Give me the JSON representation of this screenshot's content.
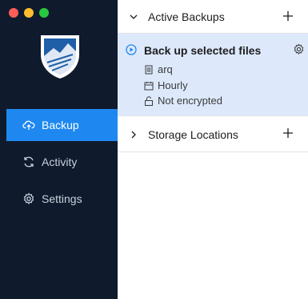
{
  "window": {
    "controls": {
      "close_color": "#ff5f57",
      "minimize_color": "#febc2e",
      "zoom_color": "#28c840"
    }
  },
  "sidebar": {
    "logo_icon": "arq-shield-logo",
    "items": [
      {
        "label": "Backup",
        "icon": "backup-cloud-icon",
        "active": true
      },
      {
        "label": "Activity",
        "icon": "refresh-icon",
        "active": false
      },
      {
        "label": "Settings",
        "icon": "gear-icon",
        "active": false
      }
    ]
  },
  "main": {
    "active_backups": {
      "title": "Active Backups",
      "expanded": true,
      "plans": [
        {
          "name": "Back up selected files",
          "destination": "arq",
          "schedule": "Hourly",
          "encryption": "Not encrypted"
        }
      ]
    },
    "storage_locations": {
      "title": "Storage Locations",
      "expanded": false
    }
  },
  "colors": {
    "sidebar_bg": "#0f1a2d",
    "accent": "#1e88f0",
    "selected_card_bg": "#dde9fb"
  }
}
